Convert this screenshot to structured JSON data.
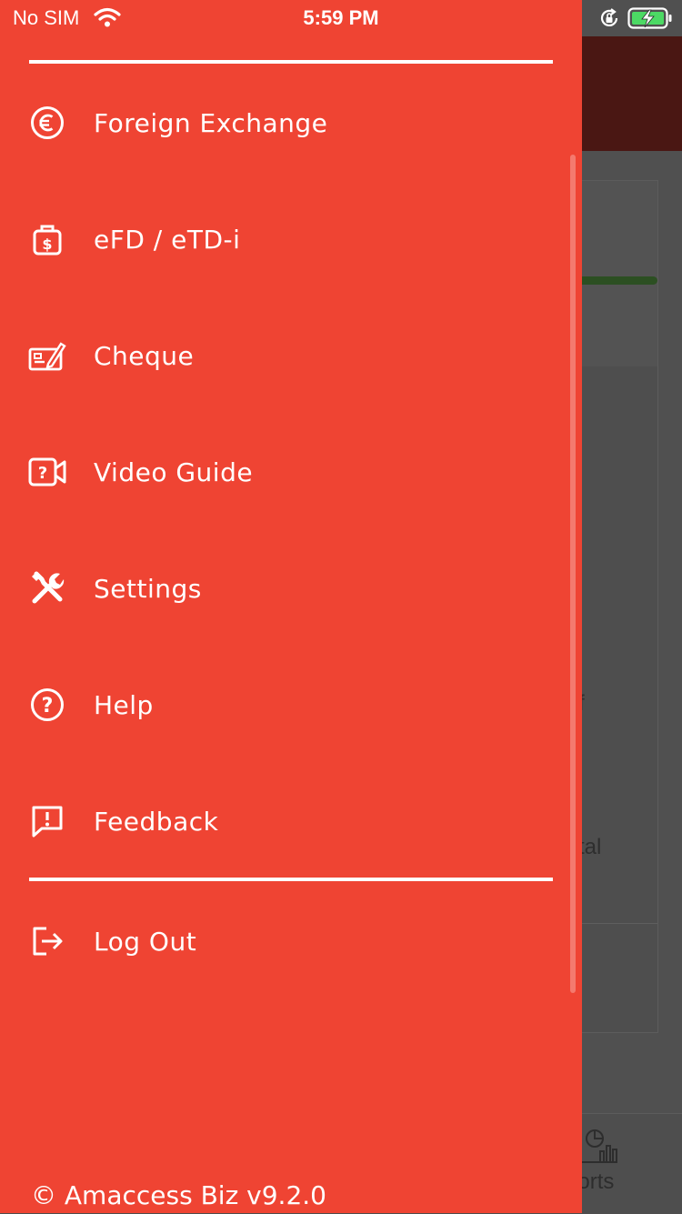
{
  "status_bar": {
    "carrier": "No SIM",
    "time": "5:59 PM",
    "battery_color": "#4cd964"
  },
  "drawer": {
    "background_color": "#ef4433",
    "menu_items": [
      {
        "label": "Foreign Exchange",
        "icon": "euro-circle-icon"
      },
      {
        "label": "eFD / eTD-i",
        "icon": "dollar-bag-icon"
      },
      {
        "label": "Cheque",
        "icon": "cheque-icon"
      },
      {
        "label": "Video Guide",
        "icon": "video-help-icon"
      },
      {
        "label": "Settings",
        "icon": "tools-icon"
      },
      {
        "label": "Help",
        "icon": "help-circle-icon"
      },
      {
        "label": "Feedback",
        "icon": "feedback-icon"
      }
    ],
    "logout": {
      "label": "Log Out",
      "icon": "logout-icon"
    },
    "version": "© Amaccess Biz v9.2.0"
  },
  "background_app": {
    "fragment_1": "f",
    "fragment_2": "tal",
    "tab_label_fragment": "ports",
    "progress_color": "#2c4f22"
  }
}
